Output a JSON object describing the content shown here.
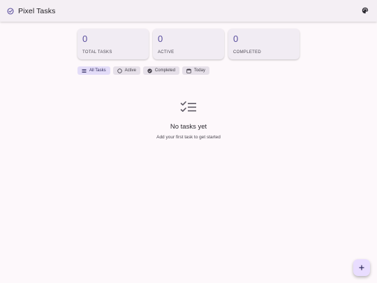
{
  "app": {
    "title": "Pixel Tasks",
    "accent_color": "#5b4f9e",
    "icons": {
      "logo": "check-circle-icon",
      "theme": "palette-icon",
      "fab": "plus-icon"
    }
  },
  "stats": [
    {
      "value": "0",
      "label": "TOTAL TASKS"
    },
    {
      "value": "0",
      "label": "ACTIVE"
    },
    {
      "value": "0",
      "label": "COMPLETED"
    }
  ],
  "filters": [
    {
      "label": "All Tasks",
      "icon": "list-icon",
      "selected": true
    },
    {
      "label": "Active",
      "icon": "circle-outline-icon",
      "selected": false
    },
    {
      "label": "Completed",
      "icon": "check-circle-filled-icon",
      "selected": false
    },
    {
      "label": "Today",
      "icon": "calendar-icon",
      "selected": false
    }
  ],
  "empty_state": {
    "icon": "checklist-icon",
    "title": "No tasks yet",
    "subtitle": "Add your first task to get started"
  }
}
